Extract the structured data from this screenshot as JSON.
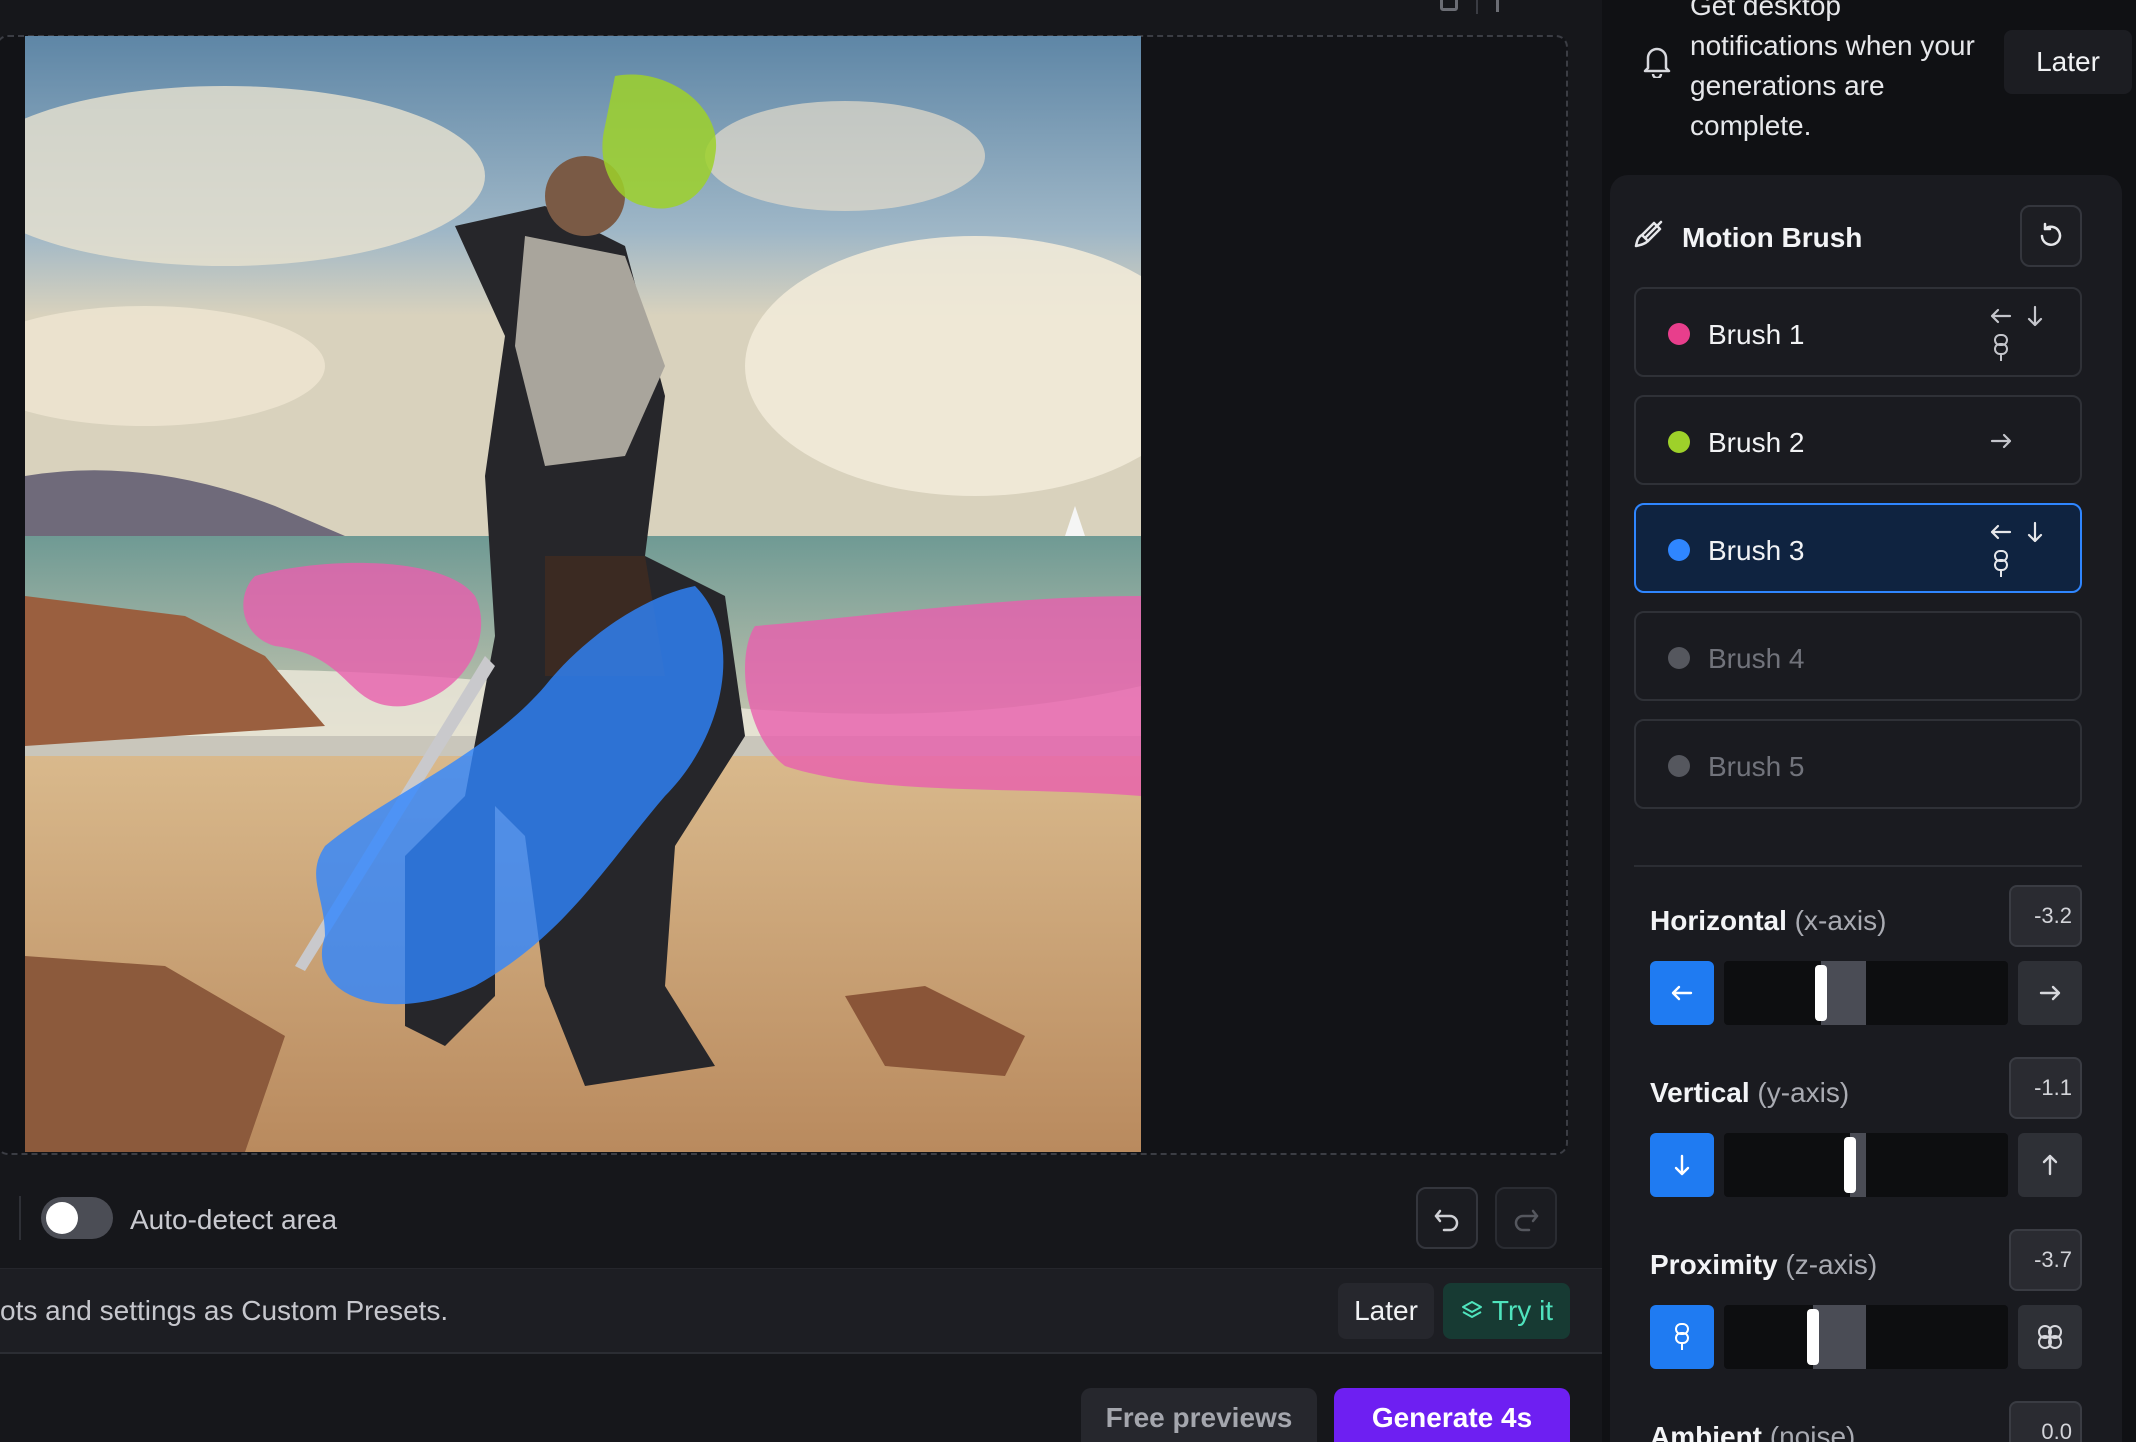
{
  "canvas": {
    "auto_detect_label": "Auto-detect area",
    "auto_detect_on": false
  },
  "presets_banner": {
    "text": "ots and settings as Custom Presets.",
    "later_label": "Later",
    "try_label": "Try it"
  },
  "generate": {
    "free_previews_label": "Free previews",
    "generate_label": "Generate 4s"
  },
  "notification": {
    "text": "Get desktop notifications when your generations are complete.",
    "later_label": "Later"
  },
  "motion_brush": {
    "title": "Motion Brush",
    "brushes": [
      {
        "label": "Brush 1",
        "color": "#e83e8c",
        "state": "set",
        "icons": [
          "arrow-left-icon",
          "arrow-down-icon",
          "proximity-icon"
        ]
      },
      {
        "label": "Brush 2",
        "color": "#9ed12a",
        "state": "set",
        "icons": [
          "arrow-right-icon"
        ]
      },
      {
        "label": "Brush 3",
        "color": "#2f86ff",
        "state": "active",
        "icons": [
          "arrow-left-icon",
          "arrow-down-icon",
          "proximity-icon"
        ]
      },
      {
        "label": "Brush 4",
        "color": "#55575e",
        "state": "empty",
        "icons": []
      },
      {
        "label": "Brush 5",
        "color": "#55575e",
        "state": "empty",
        "icons": []
      }
    ],
    "axes": [
      {
        "name": "Horizontal",
        "axis": "(x-axis)",
        "value": "-3.2",
        "level": -3.2
      },
      {
        "name": "Vertical",
        "axis": "(y-axis)",
        "value": "-1.1",
        "level": -1.1
      },
      {
        "name": "Proximity",
        "axis": "(z-axis)",
        "value": "-3.7",
        "level": -3.7
      },
      {
        "name": "Ambient",
        "axis": "(noise)",
        "value": "0.0",
        "level": 0.0
      }
    ],
    "axis_range": [
      -10,
      10
    ]
  },
  "colors": {
    "accent_blue": "#2f86ff",
    "generate_purple": "#6e1ff2",
    "try_green": "#4fe3bd"
  }
}
